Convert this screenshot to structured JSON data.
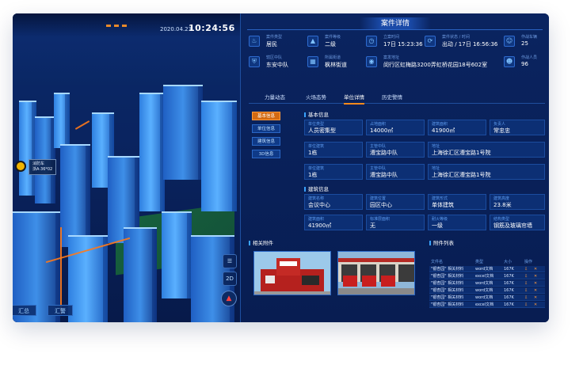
{
  "map": {
    "date": "2020.04.23",
    "time": "10:24:56",
    "poi_label": "消防车",
    "poi_sub": "浙A·36*02",
    "ctrl_list": "☰",
    "ctrl_2d": "2D",
    "compass": "▲",
    "bottom_tabs": [
      "汇总",
      "汇警"
    ]
  },
  "panel": {
    "title": "案件详情",
    "info": [
      {
        "icon": "fire-icon",
        "label": "案件类型",
        "value": "居民"
      },
      {
        "icon": "warning-icon",
        "label": "案件等级",
        "value": "二级"
      },
      {
        "icon": "clock-icon",
        "label": "立案时间",
        "value": "17日 15:23:36"
      },
      {
        "icon": "refresh-icon",
        "label": "案件状态 / 时间",
        "value": "出动 / 17日 16:56:36"
      },
      {
        "icon": "user-icon",
        "label": "作战车辆",
        "value": "25"
      },
      {
        "icon": "shield-icon",
        "label": "辖区中队",
        "value": "东安中队"
      },
      {
        "icon": "building-icon",
        "label": "所属街道",
        "value": "枫林街道"
      },
      {
        "icon": "location-icon",
        "label": "案发地址",
        "value": "闵行区虹梅路3200弄虹桥花园18号602室"
      },
      {
        "icon": "people-icon",
        "label": "作战人员",
        "value": "96"
      }
    ],
    "tabs": [
      "力量动态",
      "火场态势",
      "单位详情",
      "历史警情"
    ],
    "side_buttons": [
      "基本信息",
      "单位信息",
      "建筑信息",
      "3D信息"
    ],
    "basic_section": "基本信息",
    "basic_fields": [
      {
        "label": "单位类型",
        "value": "人员密集型"
      },
      {
        "label": "占地面积",
        "value": "14000㎡"
      },
      {
        "label": "建筑面积",
        "value": "41900㎡"
      },
      {
        "label": "负责人",
        "value": "常忠忠"
      },
      {
        "label": "单位建筑",
        "value": "1栋"
      },
      {
        "label": "主管中队",
        "value": "漕宝路中队"
      },
      {
        "label": "地址",
        "value": "上海徐汇区漕宝路1号院"
      },
      {
        "label": "单位建筑",
        "value": "1栋"
      },
      {
        "label": "主管中队",
        "value": "漕宝路中队"
      },
      {
        "label": "地址",
        "value": "上海徐汇区漕宝路1号院"
      }
    ],
    "building_section": "建筑信息",
    "building_fields": [
      {
        "label": "建筑名称",
        "value": "会议中心"
      },
      {
        "label": "建筑位置",
        "value": "园区中心"
      },
      {
        "label": "建筑形式",
        "value": "单体建筑"
      },
      {
        "label": "建筑高度",
        "value": "23.8米"
      },
      {
        "label": "建筑面积",
        "value": "41900㎡"
      },
      {
        "label": "标准层面积",
        "value": "无"
      },
      {
        "label": "耐火等级",
        "value": "一级"
      },
      {
        "label": "结构类型",
        "value": "钢筋及玻璃帘墙"
      }
    ],
    "photos_section": "相关附件",
    "files_section": "附件列表",
    "file_headers": [
      "文件名",
      "类型",
      "大小",
      "操作"
    ],
    "files": [
      {
        "name": "\"银杏园\" 相关材料",
        "type": "word文档",
        "size": "167K"
      },
      {
        "name": "\"银杏园\" 相关材料",
        "type": "excel文档",
        "size": "167K"
      },
      {
        "name": "\"银杏园\" 相关材料",
        "type": "word文档",
        "size": "167K"
      },
      {
        "name": "\"银杏园\" 相关材料",
        "type": "word文档",
        "size": "167K"
      },
      {
        "name": "\"银杏园\" 相关材料",
        "type": "word文档",
        "size": "167K"
      },
      {
        "name": "\"银杏园\" 相关材料",
        "type": "excel文档",
        "size": "167K"
      }
    ]
  }
}
